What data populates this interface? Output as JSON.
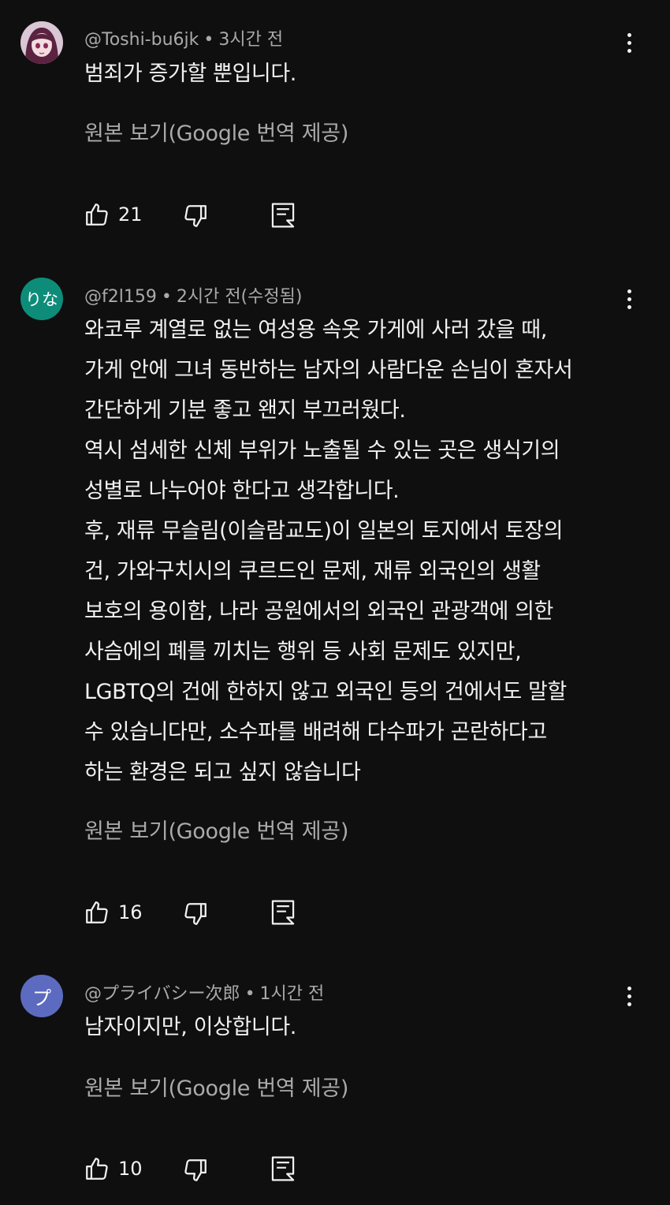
{
  "comments": [
    {
      "handle": "@Toshi-bu6jk",
      "separator": "•",
      "time": "3시간 전",
      "avatar_text": "",
      "avatar_color": "#7a3a5c",
      "text": "범죄가 증가할 뿐입니다.",
      "translate_label": "원본 보기(Google 번역 제공)",
      "likes": "21"
    },
    {
      "handle": "@f2l159",
      "separator": "•",
      "time": "2시간 전(수정됨)",
      "avatar_text": "りな",
      "avatar_color": "#0e8c7a",
      "text": "와코루 계열로 없는 여성용 속옷 가게에 사러 갔을 때,\n가게 안에 그녀 동반하는 남자의 사람다운 손님이 혼자서\n간단하게 기분 좋고 왠지 부끄러웠다.\n역시 섬세한 신체 부위가 노출될 수 있는 곳은 생식기의\n성별로 나누어야 한다고 생각합니다.\n후, 재류 무슬림(이슬람교도)이 일본의 토지에서 토장의\n건, 가와구치시의 쿠르드인 문제, 재류 외국인의 생활\n보호의 용이함, 나라 공원에서의 외국인 관광객에 의한\n사슴에의 폐를 끼치는 행위 등 사회 문제도 있지만,\nLGBTQ의 건에 한하지 않고 외국인 등의 건에서도 말할\n수 있습니다만, 소수파를 배려해 다수파가 곤란하다고\n하는 환경은 되고 싶지 않습니다",
      "translate_label": "원본 보기(Google 번역 제공)",
      "likes": "16"
    },
    {
      "handle": "@プライバシー次郎",
      "separator": "•",
      "time": "1시간 전",
      "avatar_text": "プ",
      "avatar_color": "#5c6bc0",
      "text": "남자이지만, 이상합니다.",
      "translate_label": "원본 보기(Google 번역 제공)",
      "likes": "10"
    }
  ]
}
